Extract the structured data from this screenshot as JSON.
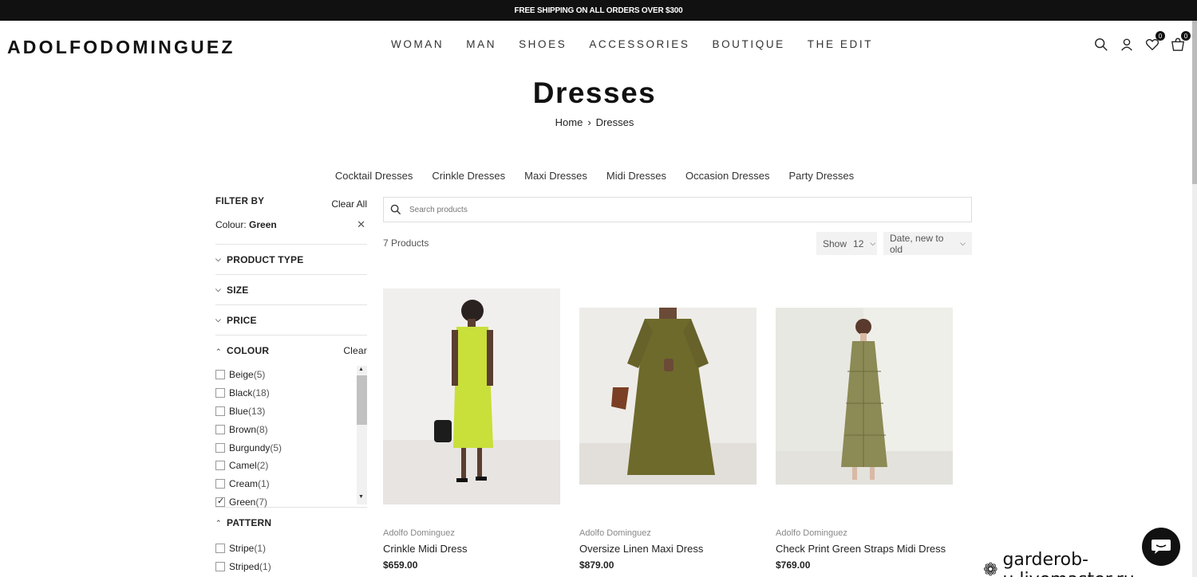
{
  "promo": "FREE SHIPPING ON ALL ORDERS OVER $300",
  "logo": "ADOLFODOMINGUEZ",
  "nav": [
    "WOMAN",
    "MAN",
    "SHOES",
    "ACCESSORIES",
    "BOUTIQUE",
    "THE EDIT"
  ],
  "header": {
    "wishlist_count": "0",
    "cart_count": "0"
  },
  "page_title": "Dresses",
  "breadcrumb": {
    "home": "Home",
    "current": "Dresses"
  },
  "subcategories": [
    "Cocktail Dresses",
    "Crinkle Dresses",
    "Maxi Dresses",
    "Midi Dresses",
    "Occasion Dresses",
    "Party Dresses"
  ],
  "filters": {
    "filter_by": "FILTER BY",
    "clear_all": "Clear All",
    "active_label": "Colour:",
    "active_value": "Green",
    "sections": [
      "PRODUCT TYPE",
      "SIZE",
      "PRICE"
    ],
    "colour_title": "COLOUR",
    "colour_clear": "Clear",
    "colours": [
      {
        "name": "Beige",
        "count": "(5)",
        "checked": false
      },
      {
        "name": "Black",
        "count": "(18)",
        "checked": false
      },
      {
        "name": "Blue",
        "count": "(13)",
        "checked": false
      },
      {
        "name": "Brown",
        "count": "(8)",
        "checked": false
      },
      {
        "name": "Burgundy",
        "count": "(5)",
        "checked": false
      },
      {
        "name": "Camel",
        "count": "(2)",
        "checked": false
      },
      {
        "name": "Cream",
        "count": "(1)",
        "checked": false
      },
      {
        "name": "Green",
        "count": "(7)",
        "checked": true
      }
    ],
    "pattern_title": "PATTERN",
    "patterns": [
      {
        "name": "Stripe",
        "count": "(1)"
      },
      {
        "name": "Striped",
        "count": "(1)"
      }
    ]
  },
  "search": {
    "placeholder": "Search products"
  },
  "product_count": "7 Products",
  "show": {
    "label": "Show",
    "value": "12"
  },
  "sort": {
    "value": "Date, new to old"
  },
  "products": [
    {
      "brand": "Adolfo Dominguez",
      "name": "Crinkle Midi Dress",
      "price": "$659.00",
      "dress_color": "#c9df3a",
      "bg": "#f2f0ee"
    },
    {
      "brand": "Adolfo Dominguez",
      "name": "Oversize Linen Maxi Dress",
      "price": "$879.00",
      "dress_color": "#6e6a2c",
      "bg": "#eeece8"
    },
    {
      "brand": "Adolfo Dominguez",
      "name": "Check Print Green Straps Midi Dress",
      "price": "$769.00",
      "dress_color": "#8c8a55",
      "bg": "#efefe9"
    }
  ],
  "watermark": "garderob-u.livemaster.ru"
}
